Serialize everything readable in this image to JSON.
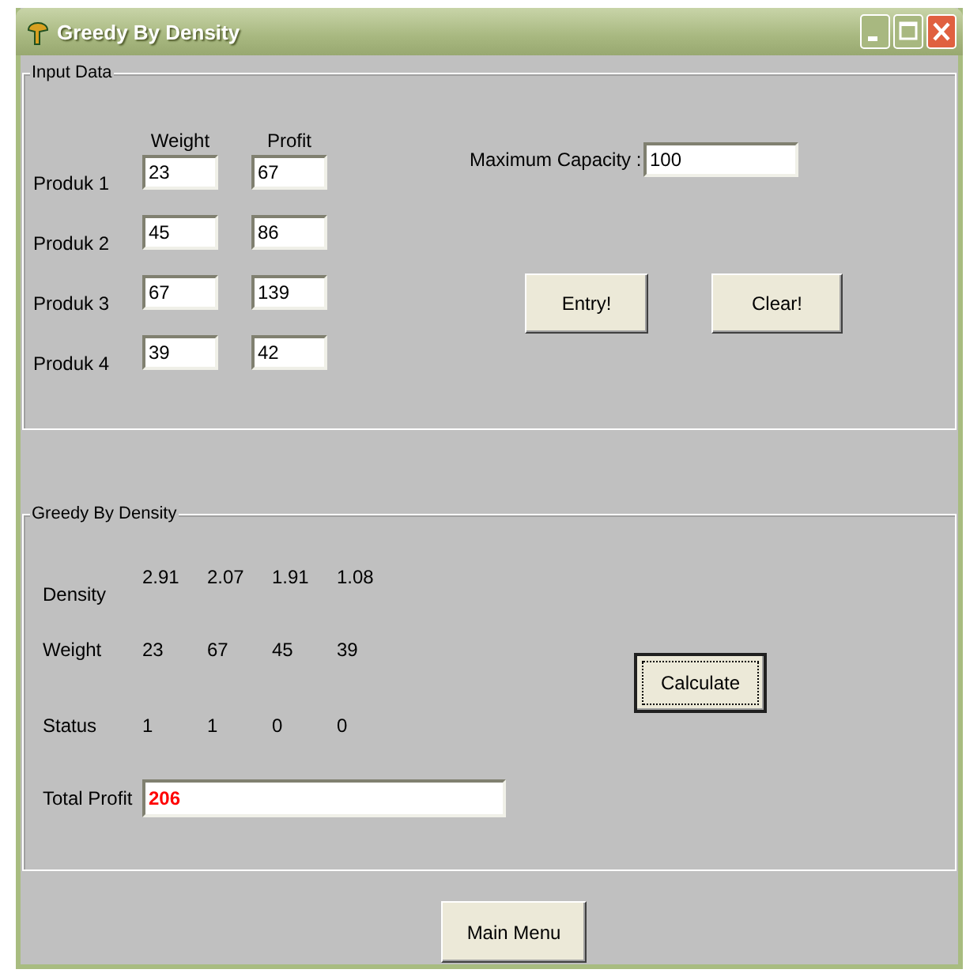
{
  "window": {
    "title": "Greedy By Density"
  },
  "input_data": {
    "legend": "Input Data",
    "column_headers": [
      "Weight",
      "Profit"
    ],
    "products": [
      {
        "label": "Produk 1",
        "weight": "23",
        "profit": "67"
      },
      {
        "label": "Produk 2",
        "weight": "45",
        "profit": "86"
      },
      {
        "label": "Produk 3",
        "weight": "67",
        "profit": "139"
      },
      {
        "label": "Produk 4",
        "weight": "39",
        "profit": "42"
      }
    ],
    "capacity": {
      "label": "Maximum Capacity :",
      "value": "100"
    },
    "buttons": [
      "Entry!",
      "Clear!"
    ]
  },
  "result": {
    "legend": "Greedy By Density",
    "rows": [
      {
        "label": "Density",
        "values": [
          "2.91",
          "2.07",
          "1.91",
          "1.08"
        ]
      },
      {
        "label": "Weight",
        "values": [
          "23",
          "67",
          "45",
          "39"
        ]
      },
      {
        "label": "Status",
        "values": [
          "1",
          "1",
          "0",
          "0"
        ]
      }
    ],
    "total_profit": {
      "label": "Total Profit",
      "value": "206"
    },
    "calculate": {
      "label": "Calculate",
      "focused": true
    }
  },
  "main_menu": "Main Menu"
}
